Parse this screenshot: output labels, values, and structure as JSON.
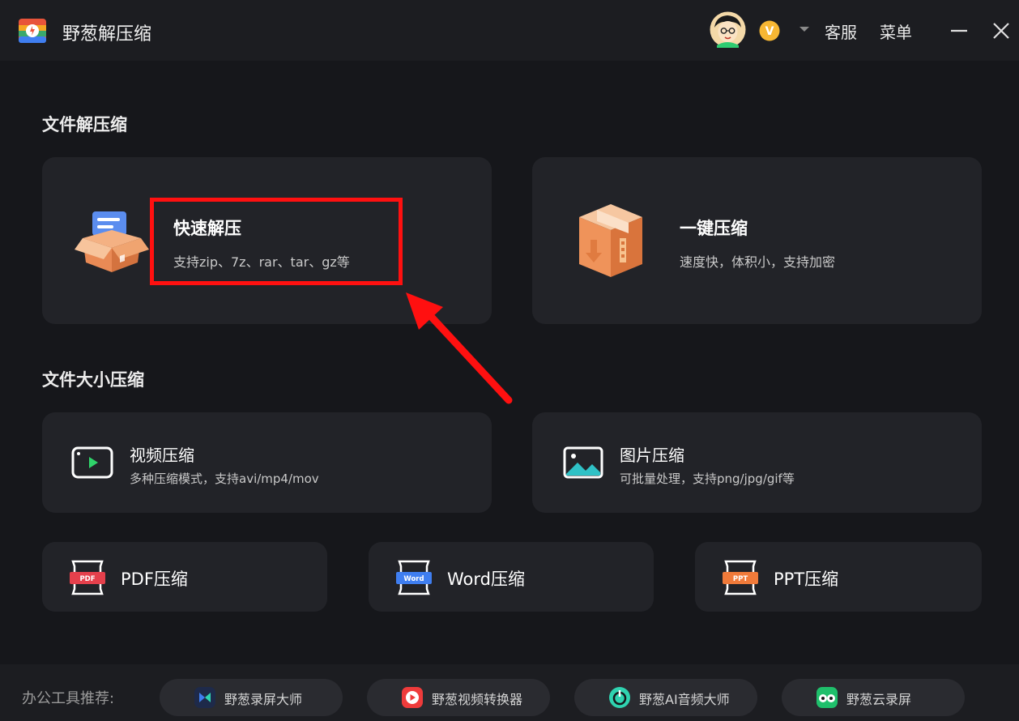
{
  "app": {
    "title": "野葱解压缩"
  },
  "header": {
    "service_label": "客服",
    "menu_label": "菜单",
    "vip_badge_text": "V"
  },
  "sections": {
    "decompress_title": "文件解压缩",
    "size_compress_title": "文件大小压缩"
  },
  "cards": {
    "quick_extract": {
      "title": "快速解压",
      "desc": "支持zip、7z、rar、tar、gz等"
    },
    "one_click_compress": {
      "title": "一键压缩",
      "desc": "速度快，体积小，支持加密"
    },
    "video_compress": {
      "title": "视频压缩",
      "desc": "多种压缩模式，支持avi/mp4/mov"
    },
    "image_compress": {
      "title": "图片压缩",
      "desc": "可批量处理，支持png/jpg/gif等"
    },
    "pdf_compress": {
      "title": "PDF压缩",
      "icon_text": "PDF"
    },
    "word_compress": {
      "title": "Word压缩",
      "icon_text": "Word"
    },
    "ppt_compress": {
      "title": "PPT压缩",
      "icon_text": "PPT"
    }
  },
  "footer": {
    "label": "办公工具推荐:",
    "tools": [
      {
        "label": "野葱录屏大师",
        "icon": "screen-recorder-icon"
      },
      {
        "label": "野葱视频转换器",
        "icon": "video-converter-icon"
      },
      {
        "label": "野葱AI音频大师",
        "icon": "audio-master-icon"
      },
      {
        "label": "野葱云录屏",
        "icon": "cloud-recorder-icon"
      }
    ]
  },
  "colors": {
    "background": "#16171b",
    "card": "#222328",
    "highlight": "#ff1010",
    "pdf": "#e5404c",
    "word": "#3f7ef0",
    "ppt": "#f07a3a"
  }
}
